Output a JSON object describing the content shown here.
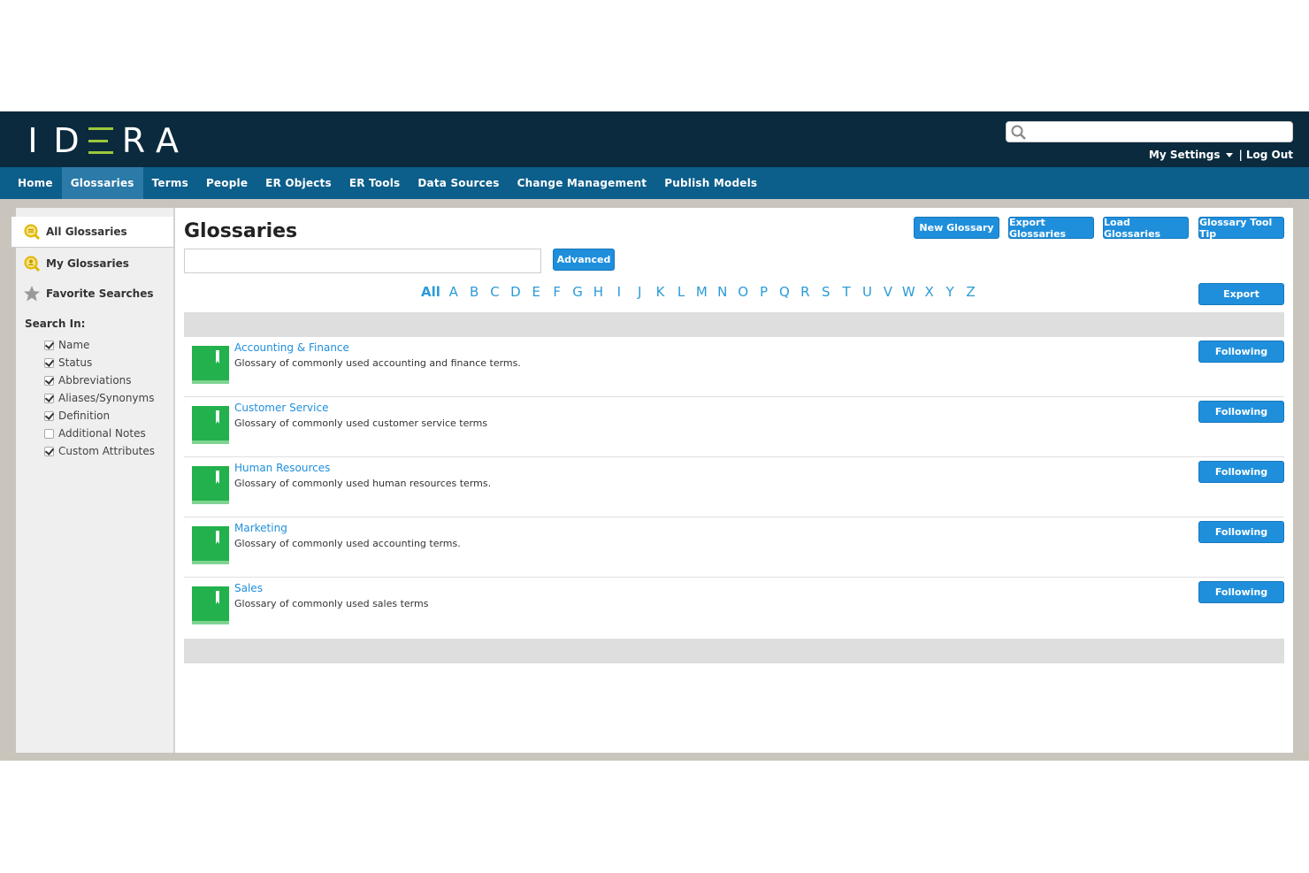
{
  "header": {
    "logo_letters": [
      "I",
      "D",
      "R",
      "A"
    ],
    "search_placeholder": "",
    "my_settings": "My Settings",
    "separator": "|",
    "log_out": "Log Out"
  },
  "nav": {
    "items": [
      {
        "label": "Home",
        "active": false
      },
      {
        "label": "Glossaries",
        "active": true
      },
      {
        "label": "Terms",
        "active": false
      },
      {
        "label": "People",
        "active": false
      },
      {
        "label": "ER Objects",
        "active": false
      },
      {
        "label": "ER Tools",
        "active": false
      },
      {
        "label": "Data Sources",
        "active": false
      },
      {
        "label": "Change Management",
        "active": false
      },
      {
        "label": "Publish Models",
        "active": false
      }
    ]
  },
  "sidebar": {
    "all_glossaries": "All Glossaries",
    "my_glossaries": "My Glossaries",
    "favorite_searches": "Favorite Searches",
    "search_in": "Search In:",
    "options": [
      {
        "label": "Name",
        "checked": true
      },
      {
        "label": "Status",
        "checked": true
      },
      {
        "label": "Abbreviations",
        "checked": true
      },
      {
        "label": "Aliases/Synonyms",
        "checked": true
      },
      {
        "label": "Definition",
        "checked": true
      },
      {
        "label": "Additional Notes",
        "checked": false
      },
      {
        "label": "Custom Attributes",
        "checked": true
      }
    ]
  },
  "main": {
    "title": "Glossaries",
    "buttons": {
      "new_glossary": "New Glossary",
      "export_glossaries": "Export Glossaries",
      "load_glossaries": "Load Glossaries",
      "glossary_tool_tip": "Glossary Tool Tip",
      "advanced": "Advanced",
      "export": "Export"
    },
    "search_value": "",
    "alphabet": [
      "All",
      "A",
      "B",
      "C",
      "D",
      "E",
      "F",
      "G",
      "H",
      "I",
      "J",
      "K",
      "L",
      "M",
      "N",
      "O",
      "P",
      "Q",
      "R",
      "S",
      "T",
      "U",
      "V",
      "W",
      "X",
      "Y",
      "Z"
    ],
    "glossaries": [
      {
        "title": "Accounting & Finance",
        "description": "Glossary of commonly used accounting and finance terms.",
        "status": "Following"
      },
      {
        "title": "Customer Service",
        "description": "Glossary of commonly used customer service terms",
        "status": "Following"
      },
      {
        "title": "Human Resources",
        "description": "Glossary of commonly used human resources terms.",
        "status": "Following"
      },
      {
        "title": "Marketing",
        "description": "Glossary of commonly used accounting terms.",
        "status": "Following"
      },
      {
        "title": "Sales",
        "description": "Glossary of commonly used sales terms",
        "status": "Following"
      }
    ]
  },
  "colors": {
    "header_bg": "#0b2a3d",
    "nav_bg": "#0c5e8b",
    "accent_green": "#9bc83c",
    "button_blue": "#1f8fdc",
    "book_green": "#22b14c"
  }
}
